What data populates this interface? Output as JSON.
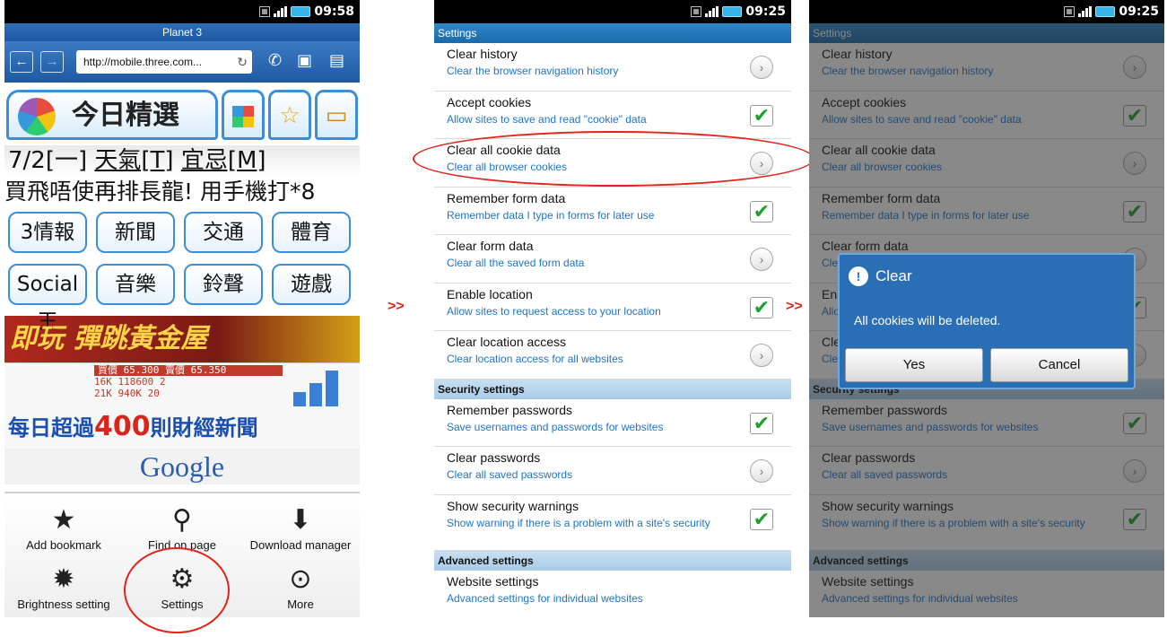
{
  "status_bar": {
    "time_1": "09:58",
    "time_2": "09:25",
    "time_3": "09:25"
  },
  "browser": {
    "window_title": "Planet 3",
    "url": "http://mobile.three.com...",
    "nav_back_icon": "arrow-left-icon",
    "nav_forward_icon": "arrow-right-icon",
    "reload_icon": "reload-icon",
    "portal": {
      "main_tab": "今日精選",
      "date_line": [
        "7/2[一] ",
        "天氣[T]",
        " ",
        "宜忌[M]"
      ],
      "promo": "買飛唔使再排長龍! 用手機打*8",
      "categories": [
        [
          "3情報",
          "新聞",
          "交通",
          "體育"
        ],
        [
          "Social王",
          "音樂",
          "鈴聲",
          "遊戲"
        ]
      ],
      "game_banner": "即玩 彈跳黃金屋",
      "finance_banner": {
        "table_rows": [
          "買價    65.300 賣價   65.350",
          "16K       118600        2",
          "21K       940K         20"
        ],
        "slogan_prefix": "每日超過",
        "slogan_number": "400",
        "slogan_suffix": "則財經新聞"
      },
      "google": "Google"
    },
    "menu": [
      {
        "label": "Add bookmark",
        "icon": "add-bookmark-icon",
        "glyph": "★"
      },
      {
        "label": "Find on page",
        "icon": "search-icon",
        "glyph": "⚲"
      },
      {
        "label": "Download manager",
        "icon": "download-icon",
        "glyph": "⬇"
      },
      {
        "label": "Brightness setting",
        "icon": "brightness-icon",
        "glyph": "✹"
      },
      {
        "label": "Settings",
        "icon": "gear-icon",
        "glyph": "⚙"
      },
      {
        "label": "More",
        "icon": "more-icon",
        "glyph": "⊙"
      }
    ]
  },
  "separator": ">>",
  "settings": {
    "header": "Settings",
    "items_top": [
      {
        "title": "Clear history",
        "subtitle": "Clear the browser navigation history",
        "control": "arrow"
      },
      {
        "title": "Accept cookies",
        "subtitle": "Allow sites to save and read \"cookie\" data",
        "control": "check"
      },
      {
        "title": "Clear all cookie data",
        "subtitle": "Clear all browser cookies",
        "control": "arrow"
      },
      {
        "title": "Remember form data",
        "subtitle": "Remember data I type in forms for later use",
        "control": "check"
      },
      {
        "title": "Clear form data",
        "subtitle": "Clear all the saved form data",
        "control": "arrow"
      },
      {
        "title": "Enable location",
        "subtitle": "Allow sites to request access to your location",
        "control": "check"
      },
      {
        "title": "Clear location access",
        "subtitle": "Clear location access for all websites",
        "control": "arrow"
      }
    ],
    "security_header": "Security settings",
    "items_security": [
      {
        "title": "Remember passwords",
        "subtitle": "Save usernames and passwords for websites",
        "control": "check"
      },
      {
        "title": "Clear passwords",
        "subtitle": "Clear all saved passwords",
        "control": "arrow"
      },
      {
        "title": "Show security warnings",
        "subtitle": "Show warning if there is a problem with a site's security",
        "control": "check"
      }
    ],
    "advanced_header": "Advanced settings",
    "items_advanced": [
      {
        "title": "Website settings",
        "subtitle": "Advanced settings for individual websites",
        "control": "none"
      }
    ]
  },
  "dialog": {
    "title": "Clear",
    "icon": "warning-icon",
    "message": "All cookies will be deleted.",
    "yes": "Yes",
    "cancel": "Cancel"
  },
  "colors": {
    "accent_blue": "#2a6fb5",
    "annotation_red": "#e2231a",
    "check_green": "#20a030",
    "subtitle_blue": "#1f74c9"
  }
}
